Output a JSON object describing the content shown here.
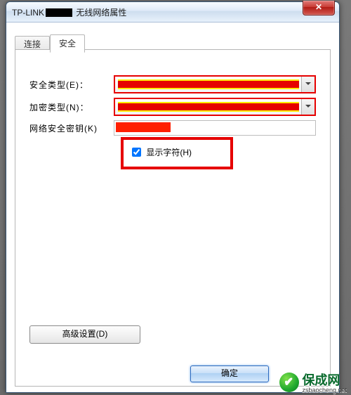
{
  "window": {
    "title_prefix": "TP-LINK",
    "title_suffix": "无线网络属性"
  },
  "tabs": {
    "connect": "连接",
    "security": "安全"
  },
  "labels": {
    "security_type": "安全类型(E)：",
    "encryption_type": "加密类型(N)：",
    "network_key": "网络安全密钥(K)",
    "show_chars": "显示字符(H)",
    "advanced": "高级设置(D)",
    "ok": "确定"
  },
  "watermark": {
    "brand": "保成网",
    "url": "zsbaocheng.net"
  }
}
